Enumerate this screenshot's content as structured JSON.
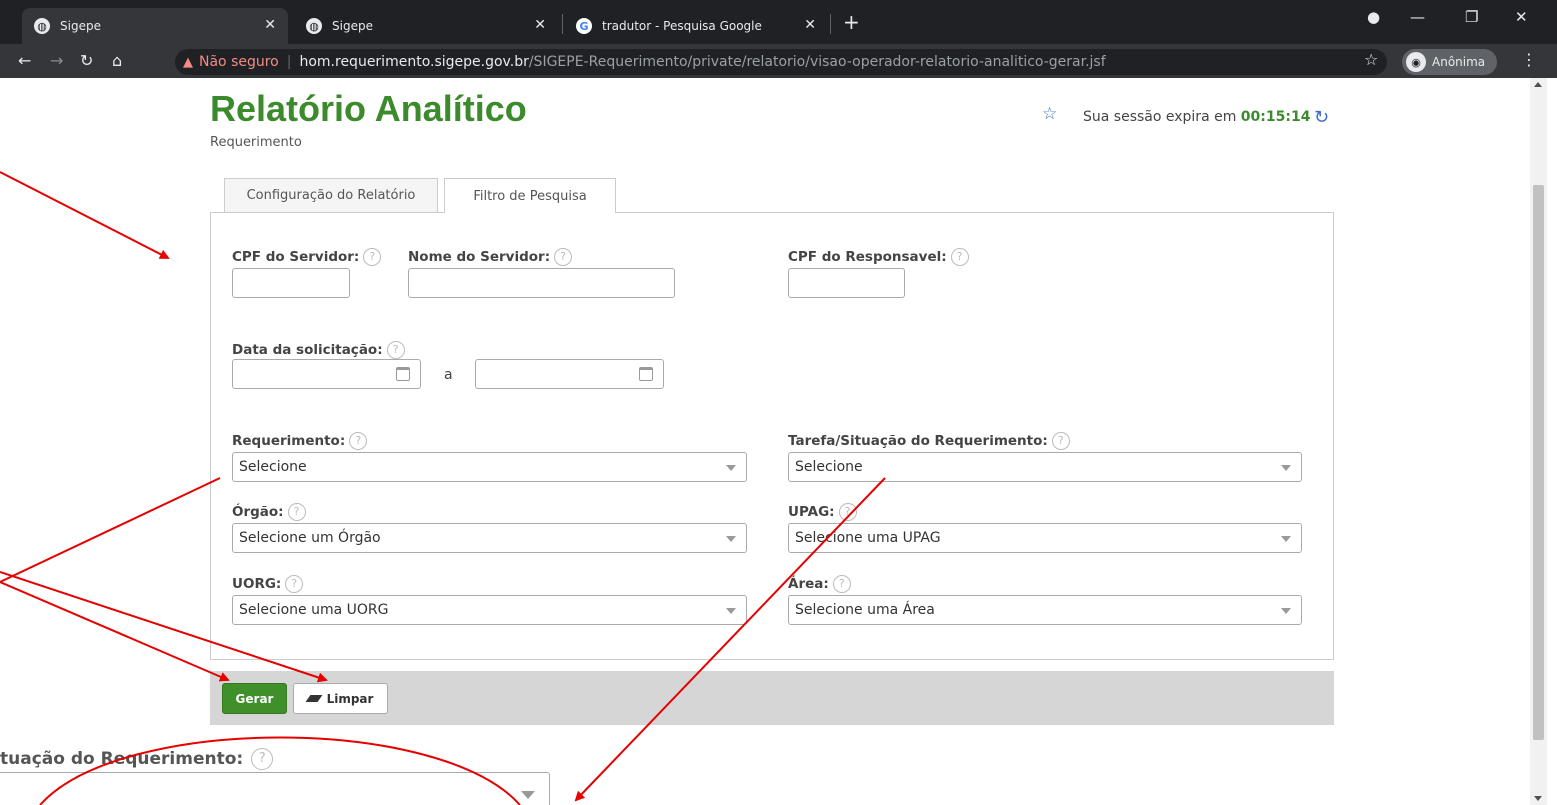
{
  "browser": {
    "tabs": [
      {
        "title": "Sigepe",
        "favicon": "globe-icon"
      },
      {
        "title": "Sigepe",
        "favicon": "globe-icon"
      },
      {
        "title": "tradutor - Pesquisa Google",
        "favicon": "google-icon"
      }
    ],
    "favicon_glyph_google": "G",
    "address": {
      "security_label": "Não seguro",
      "host": "hom.requerimento.sigepe.gov.br",
      "path": "/SIGEPE-Requerimento/private/relatorio/visao-operador-relatorio-analitico-gerar.jsf"
    },
    "profile_label": "Anônima"
  },
  "page": {
    "title": "Relatório Analítico",
    "subtitle": "Requerimento",
    "session_text": "Sua sessão expira em",
    "session_time": "00:15:14"
  },
  "tabs": {
    "config": "Configuração do Relatório",
    "filter": "Filtro de Pesquisa"
  },
  "form": {
    "help_glyph": "?",
    "cpf_servidor": {
      "label": "CPF do Servidor:",
      "value": ""
    },
    "nome_servidor": {
      "label": "Nome do Servidor:",
      "value": ""
    },
    "cpf_responsavel": {
      "label": "CPF do Responsavel:",
      "value": ""
    },
    "data_solicitacao": {
      "label": "Data da solicitação:",
      "separator": "a",
      "from": "",
      "to": ""
    },
    "requerimento": {
      "label": "Requerimento:",
      "value": "Selecione"
    },
    "tarefa_situacao": {
      "label": "Tarefa/Situação do Requerimento:",
      "value": "Selecione"
    },
    "orgao": {
      "label": "Órgão:",
      "value": "Selecione um Órgão"
    },
    "upag": {
      "label": "UPAG:",
      "value": "Selecione uma UPAG"
    },
    "uorg": {
      "label": "UORG:",
      "value": "Selecione uma UORG"
    },
    "area": {
      "label": "Área:",
      "value": "Selecione uma Área"
    }
  },
  "actions": {
    "gerar": "Gerar",
    "limpar": "Limpar"
  },
  "zoom_snippet": {
    "label": "tuação do Requerimento:"
  },
  "colors": {
    "title_green": "#3b8a2b",
    "annotation_red": "#e60000",
    "warning_red": "#f28b82"
  }
}
